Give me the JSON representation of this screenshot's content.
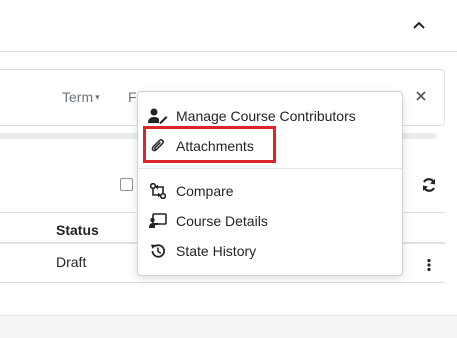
{
  "panel": {
    "collapse_icon": "chevron-up-icon",
    "close_icon": "close-icon",
    "refresh_icon": "refresh-icon",
    "kebab_icon": "kebab-vertical-icon"
  },
  "filter_bar": {
    "term_label": "Term",
    "term_caret": "▾",
    "obscured_fragment": "F"
  },
  "table": {
    "status_header": "Status",
    "rows": [
      {
        "status": "Draft"
      }
    ]
  },
  "menu": {
    "items": [
      {
        "label": "Manage Course Contributors",
        "icon": "user-edit-icon"
      },
      {
        "label": "Attachments",
        "icon": "paperclip-icon"
      },
      {
        "label": "Compare",
        "icon": "compare-icon"
      },
      {
        "label": "Course Details",
        "icon": "chalkboard-icon"
      },
      {
        "label": "State History",
        "icon": "history-icon"
      }
    ]
  },
  "colors": {
    "highlight": "#d9262a",
    "text": "#212529",
    "muted": "#6c757d",
    "border": "#dee2e6"
  }
}
